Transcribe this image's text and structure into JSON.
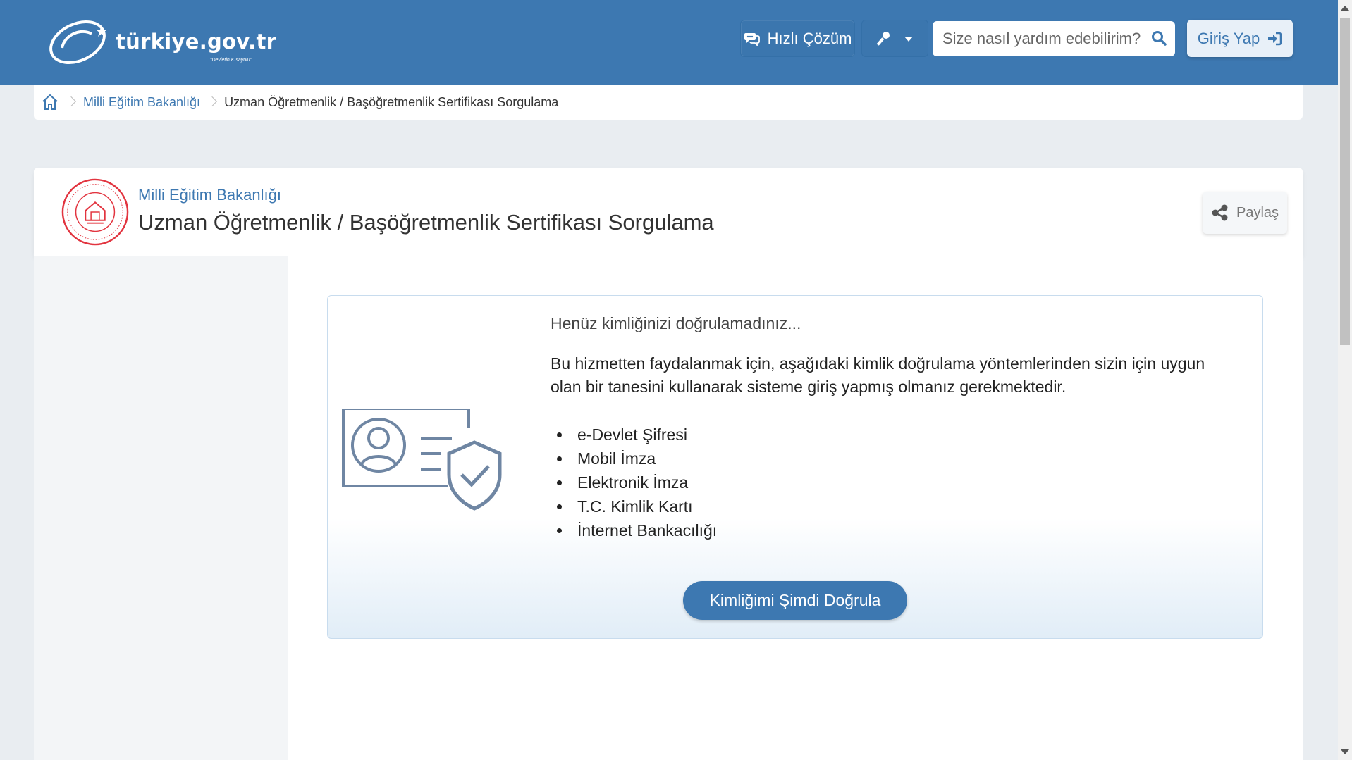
{
  "header": {
    "logo_text": "türkiye.gov.tr",
    "logo_sub": "\"Devletin Kısayolu\"",
    "quick_label": "Hızlı Çözüm",
    "search_placeholder": "Size nasıl yardım edebilirim?",
    "login_label": "Giriş Yap"
  },
  "breadcrumb": {
    "items": [
      {
        "label": "Milli Eğitim Bakanlığı"
      },
      {
        "label": "Uzman Öğretmenlik / Başöğretmenlik Sertifikası Sorgulama"
      }
    ]
  },
  "service": {
    "org_name": "Milli Eğitim Bakanlığı",
    "title": "Uzman Öğretmenlik / Başöğretmenlik Sertifikası Sorgulama",
    "share_label": "Paylaş"
  },
  "auth": {
    "title": "Henüz kimliğinizi doğrulamadınız...",
    "description": "Bu hizmetten faydalanmak için, aşağıdaki kimlik doğrulama yöntemlerinden sizin için uygun olan bir tanesini kullanarak sisteme giriş yapmış olmanız gerekmektedir.",
    "methods": [
      "e-Devlet Şifresi",
      "Mobil İmza",
      "Elektronik İmza",
      "T.C. Kimlik Kartı",
      "İnternet Bankacılığı"
    ],
    "button_label": "Kimliğimi Şimdi Doğrula"
  },
  "colors": {
    "brand": "#3d78b1",
    "header_bg": "#3d78b1",
    "page_bg": "#e9edf1",
    "seal_red": "#e2343f"
  },
  "icons": [
    "chat-icon",
    "key-icon",
    "chevron-down-icon",
    "search-icon",
    "login-arrow-icon",
    "home-icon",
    "share-icon",
    "id-card-shield-icon"
  ]
}
